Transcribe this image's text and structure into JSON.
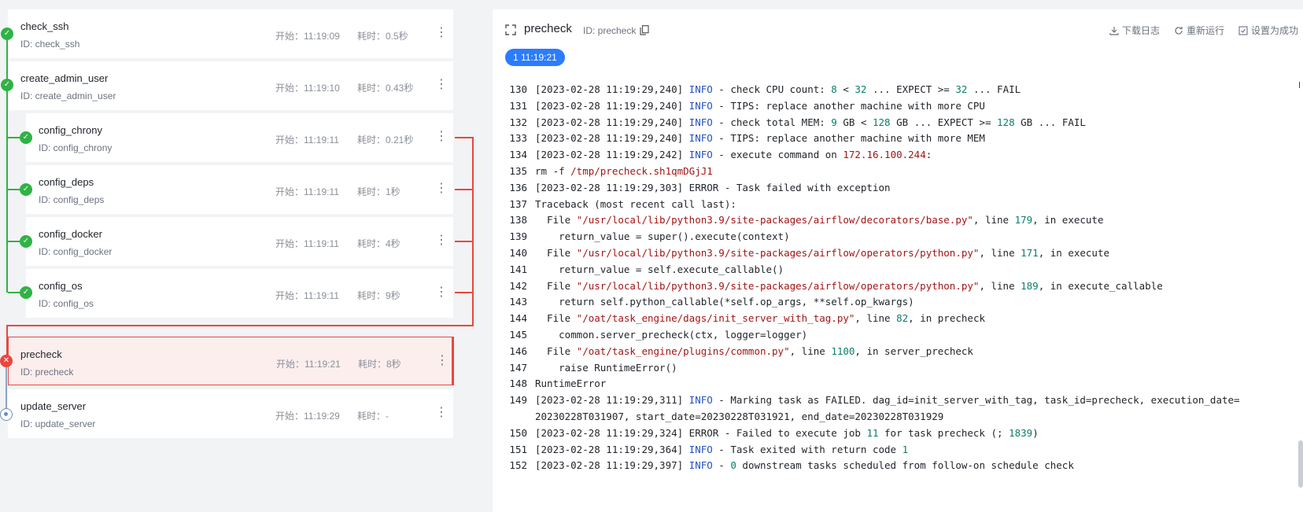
{
  "tasks": [
    {
      "name": "check_ssh",
      "id": "ID: check_ssh",
      "start": "开始：11:19:09",
      "duration": "耗时：0.5秒",
      "status": "ok"
    },
    {
      "name": "create_admin_user",
      "id": "ID: create_admin_user",
      "start": "开始：11:19:10",
      "duration": "耗时：0.43秒",
      "status": "ok"
    },
    {
      "name": "config_chrony",
      "id": "ID: config_chrony",
      "start": "开始：11:19:11",
      "duration": "耗时：0.21秒",
      "status": "ok"
    },
    {
      "name": "config_deps",
      "id": "ID: config_deps",
      "start": "开始：11:19:11",
      "duration": "耗时：1秒",
      "status": "ok"
    },
    {
      "name": "config_docker",
      "id": "ID: config_docker",
      "start": "开始：11:19:11",
      "duration": "耗时：4秒",
      "status": "ok"
    },
    {
      "name": "config_os",
      "id": "ID: config_os",
      "start": "开始：11:19:11",
      "duration": "耗时：9秒",
      "status": "ok"
    },
    {
      "name": "precheck",
      "id": "ID: precheck",
      "start": "开始：11:19:21",
      "duration": "耗时：8秒",
      "status": "failed"
    },
    {
      "name": "update_server",
      "id": "ID: update_server",
      "start": "开始：11:19:29",
      "duration": "耗时：-",
      "status": "pending"
    }
  ],
  "panel": {
    "title": "precheck",
    "id": "ID: precheck",
    "time_pill": "1 11:19:21",
    "actions": {
      "download": "下载日志",
      "rerun": "重新运行",
      "set_success": "设置为成功"
    }
  },
  "log_lines": [
    {
      "n": "130",
      "html": "[2023-02-28 11:19:29,240] <span class=\"kw-info\">INFO</span> - check CPU count: <span class=\"kw-num\">8</span> &lt; <span class=\"kw-num\">32</span> ... EXPECT &gt;= <span class=\"kw-num\">32</span> ... FAIL"
    },
    {
      "n": "131",
      "html": "[2023-02-28 11:19:29,240] <span class=\"kw-info\">INFO</span> - TIPS: replace another machine with more CPU"
    },
    {
      "n": "132",
      "html": "[2023-02-28 11:19:29,240] <span class=\"kw-info\">INFO</span> - check total MEM: <span class=\"kw-num\">9</span> GB &lt; <span class=\"kw-num\">128</span> GB ... EXPECT &gt;= <span class=\"kw-num\">128</span> GB ... FAIL"
    },
    {
      "n": "133",
      "html": "[2023-02-28 11:19:29,240] <span class=\"kw-info\">INFO</span> - TIPS: replace another machine with more MEM"
    },
    {
      "n": "134",
      "html": "[2023-02-28 11:19:29,242] <span class=\"kw-info\">INFO</span> - execute command on <span class=\"kw-ip\">172.16.100.244</span>:"
    },
    {
      "n": "135",
      "html": "rm -f <span class=\"kw-str\">/tmp/precheck.sh1qmDGjJ1</span>"
    },
    {
      "n": "136",
      "html": "[2023-02-28 11:19:29,303] ERROR - Task failed with exception"
    },
    {
      "n": "137",
      "html": "Traceback (most recent call last):"
    },
    {
      "n": "138",
      "html": "  File <span class=\"kw-str\">\"/usr/local/lib/python3.9/site-packages/airflow/decorators/base.py\"</span>, line <span class=\"kw-num\">179</span>, in execute"
    },
    {
      "n": "139",
      "html": "    return_value = super().execute(context)"
    },
    {
      "n": "140",
      "html": "  File <span class=\"kw-str\">\"/usr/local/lib/python3.9/site-packages/airflow/operators/python.py\"</span>, line <span class=\"kw-num\">171</span>, in execute"
    },
    {
      "n": "141",
      "html": "    return_value = self.execute_callable()"
    },
    {
      "n": "142",
      "html": "  File <span class=\"kw-str\">\"/usr/local/lib/python3.9/site-packages/airflow/operators/python.py\"</span>, line <span class=\"kw-num\">189</span>, in execute_callable"
    },
    {
      "n": "143",
      "html": "    return self.python_callable(*self.op_args, **self.op_kwargs)"
    },
    {
      "n": "144",
      "html": "  File <span class=\"kw-str\">\"/oat/task_engine/dags/init_server_with_tag.py\"</span>, line <span class=\"kw-num\">82</span>, in precheck"
    },
    {
      "n": "145",
      "html": "    common.server_precheck(ctx, logger=logger)"
    },
    {
      "n": "146",
      "html": "  File <span class=\"kw-str\">\"/oat/task_engine/plugins/common.py\"</span>, line <span class=\"kw-num\">1100</span>, in server_precheck"
    },
    {
      "n": "147",
      "html": "    raise RuntimeError()"
    },
    {
      "n": "148",
      "html": "RuntimeError"
    },
    {
      "n": "149",
      "html": "[2023-02-28 11:19:29,311] <span class=\"kw-info\">INFO</span> - Marking task as FAILED. dag_id=init_server_with_tag, task_id=precheck, execution_date="
    },
    {
      "n": "",
      "html": "20230228T031907, start_date=20230228T031921, end_date=20230228T031929"
    },
    {
      "n": "150",
      "html": "[2023-02-28 11:19:29,324] ERROR - Failed to execute job <span class=\"kw-num\">11</span> for task precheck (; <span class=\"kw-num\">1839</span>)"
    },
    {
      "n": "151",
      "html": "[2023-02-28 11:19:29,364] <span class=\"kw-info\">INFO</span> - Task exited with return code <span class=\"kw-num\">1</span>"
    },
    {
      "n": "152",
      "html": "[2023-02-28 11:19:29,397] <span class=\"kw-info\">INFO</span> - <span class=\"kw-num\">0</span> downstream tasks scheduled from follow-on schedule check"
    }
  ]
}
